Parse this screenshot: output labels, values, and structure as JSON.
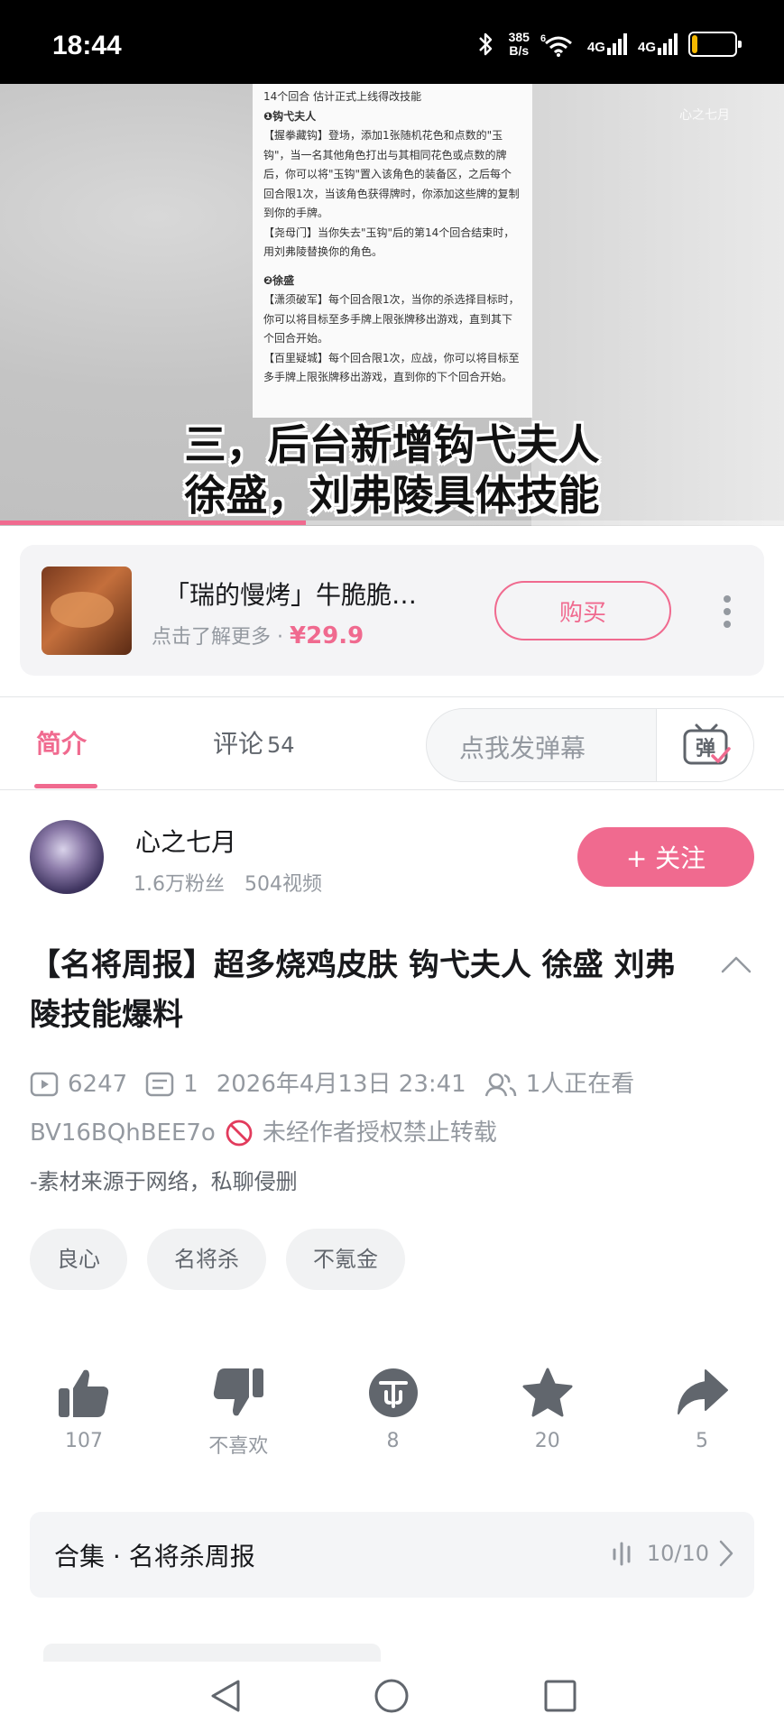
{
  "status_bar": {
    "time": "18:44",
    "speed_value": "385",
    "speed_unit": "B/s",
    "net1": "4G",
    "net2": "4G",
    "wifi_label": "6",
    "battery": "11",
    "battery_level": 0.11,
    "icons": [
      "bluetooth-icon",
      "wifi-icon",
      "signal-icon",
      "battery-icon"
    ]
  },
  "video": {
    "watermark": "心之七月",
    "doc_lines": [
      "14个回合 估计正式上线得改技能",
      "❶钩弋夫人",
      "【握拳藏钩】登场，添加1张随机花色和点数的\"玉钩\"，当一名其他角色打出与其相同花色或点数的牌后，你可以将\"玉钩\"置入该角色的装备区，之后每个回合限1次，当该角色获得牌时，你添加这些牌的复制到你的手牌。",
      "【尧母门】当你失去\"玉钩\"后的第14个回合结束时，用刘弗陵替换你的角色。",
      "❷徐盛",
      "【潇须破军】每个回合限1次，当你的杀选择目标时，你可以将目标至多手牌上限张牌移出游戏，直到其下个回合开始。",
      "【百里疑城】每个回合限1次，应战，你可以将目标至多手牌上限张牌移出游戏，直到你的下个回合开始。"
    ],
    "caption_line1": "三，后台新增钩弋夫人",
    "caption_line2": "徐盛，刘弗陵具体技能",
    "progress": 0.39
  },
  "ad": {
    "title": "「瑞的慢烤」牛脆脆…",
    "subtitle": "点击了解更多 · ",
    "price": "¥29.9",
    "buy_label": "购买"
  },
  "tabs": {
    "intro": "简介",
    "comments": "评论",
    "comments_count": "54",
    "danmaku_placeholder": "点我发弹幕",
    "danmaku_icon_text": "弹"
  },
  "uploader": {
    "name": "心之七月",
    "fans": "1.6万粉丝",
    "videos": "504视频",
    "follow_label": "+ 关注"
  },
  "video_info": {
    "title": "【名将周报】超多烧鸡皮肤 钩弋夫人 徐盛 刘弗陵技能爆料",
    "plays": "6247",
    "danmaku_count": "1",
    "date": "2026年4月13日 23:41",
    "watching": "1人正在看",
    "bvid": "BV16BQhBEE7o",
    "copyright": "未经作者授权禁止转载",
    "description": "-素材来源于网络，私聊侵删",
    "tags": [
      "良心",
      "名将杀",
      "不氪金"
    ]
  },
  "actions": {
    "like": "107",
    "dislike": "不喜欢",
    "coin": "8",
    "favorite": "20",
    "share": "5"
  },
  "collection": {
    "title": "合集 · 名将杀周报",
    "progress": "10/10"
  },
  "colors": {
    "accent": "#f06a8f",
    "text_primary": "#18191c",
    "text_secondary": "#9499a0",
    "icon_dark": "#5f646b"
  }
}
